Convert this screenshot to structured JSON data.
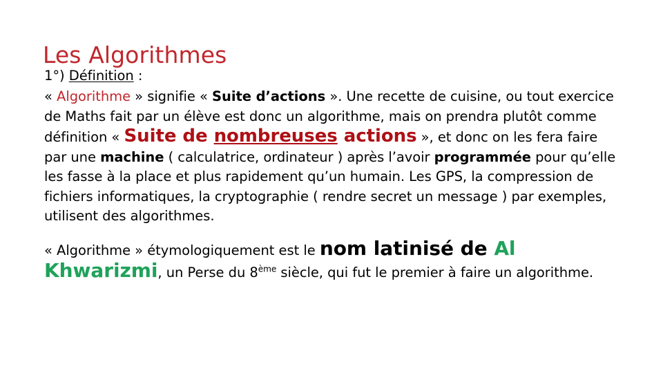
{
  "slide": {
    "title": "Les Algorithmes",
    "colors": {
      "title_red": "#C1272D",
      "emphasis_red": "#AE1015",
      "emphasis_green": "#1FA25A",
      "text_black": "#000000",
      "background": "#FFFFFF"
    },
    "heading": {
      "number": "1°) ",
      "label": "Définition",
      "colon": " :"
    },
    "definition": {
      "r1": "« ",
      "r2": "Algorithme",
      "r3": " » signifie « ",
      "r4": "Suite d’actions",
      "r5": " ». Une recette de cuisine, ou tout exercice de Maths fait par un élève est donc un algorithme, mais on prendra plutôt comme définition « ",
      "r6": "Suite de ",
      "r7": "nombreuses",
      "r8": " ",
      "r9": "actions",
      "r10": " », et donc on les fera faire par une ",
      "r11": "machine",
      "r12": " ( calculatrice, ordinateur ) après l’avoir ",
      "r13": "programmée",
      "r14": " pour qu’elle les fasse à la place et plus rapidement qu’un humain. Les GPS, la compression de fichiers informatiques, la cryptographie ( rendre secret un message ) par exemples, utilisent des algorithmes."
    },
    "etymology": {
      "r1": "« Algorithme » étymologiquement est le ",
      "r2": "nom latinisé de ",
      "r3": "Al Khwarizmi",
      "r4": ", un Perse du 8",
      "r5": "ème",
      "r6": " siècle, qui fut le premier à faire un algorithme."
    }
  }
}
